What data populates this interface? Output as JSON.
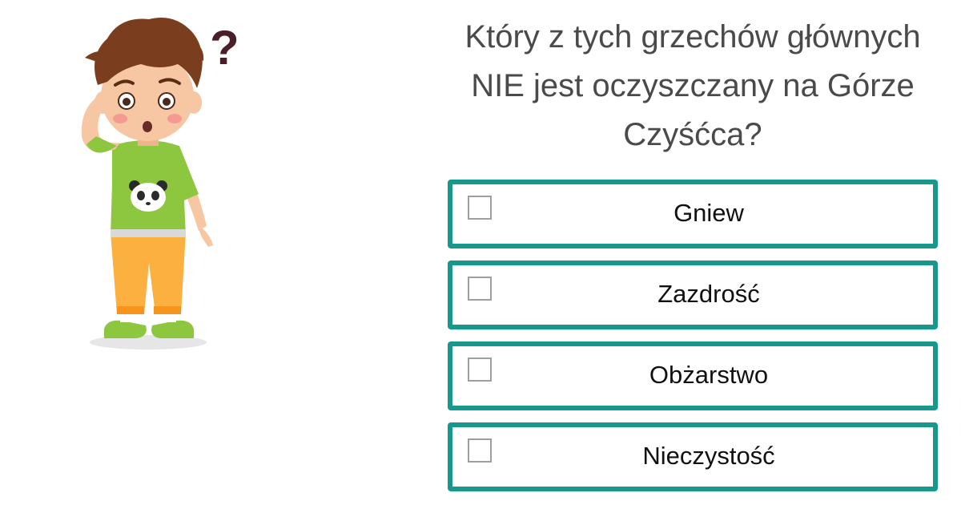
{
  "question": {
    "lines": [
      "Który z tych grzechów głównych",
      "NIE jest oczyszczany na Górze",
      "Czyśćca?"
    ]
  },
  "illustration": {
    "description_icon": "confused-boy-illustration",
    "question_mark": "?"
  },
  "options": [
    {
      "label": "Gniew",
      "checked": false
    },
    {
      "label": "Zazdrość",
      "checked": false
    },
    {
      "label": "Obżarstwo",
      "checked": false
    },
    {
      "label": "Nieczystość",
      "checked": false
    }
  ],
  "colors": {
    "accent": "#16998c",
    "question_text": "#4a4a4a",
    "option_text": "#111111",
    "checkbox_border": "#9e9e9e",
    "shirt": "#8dc63f",
    "pants": "#fbb040",
    "hair": "#7a3e1e",
    "question_mark": "#4a1f2a"
  }
}
